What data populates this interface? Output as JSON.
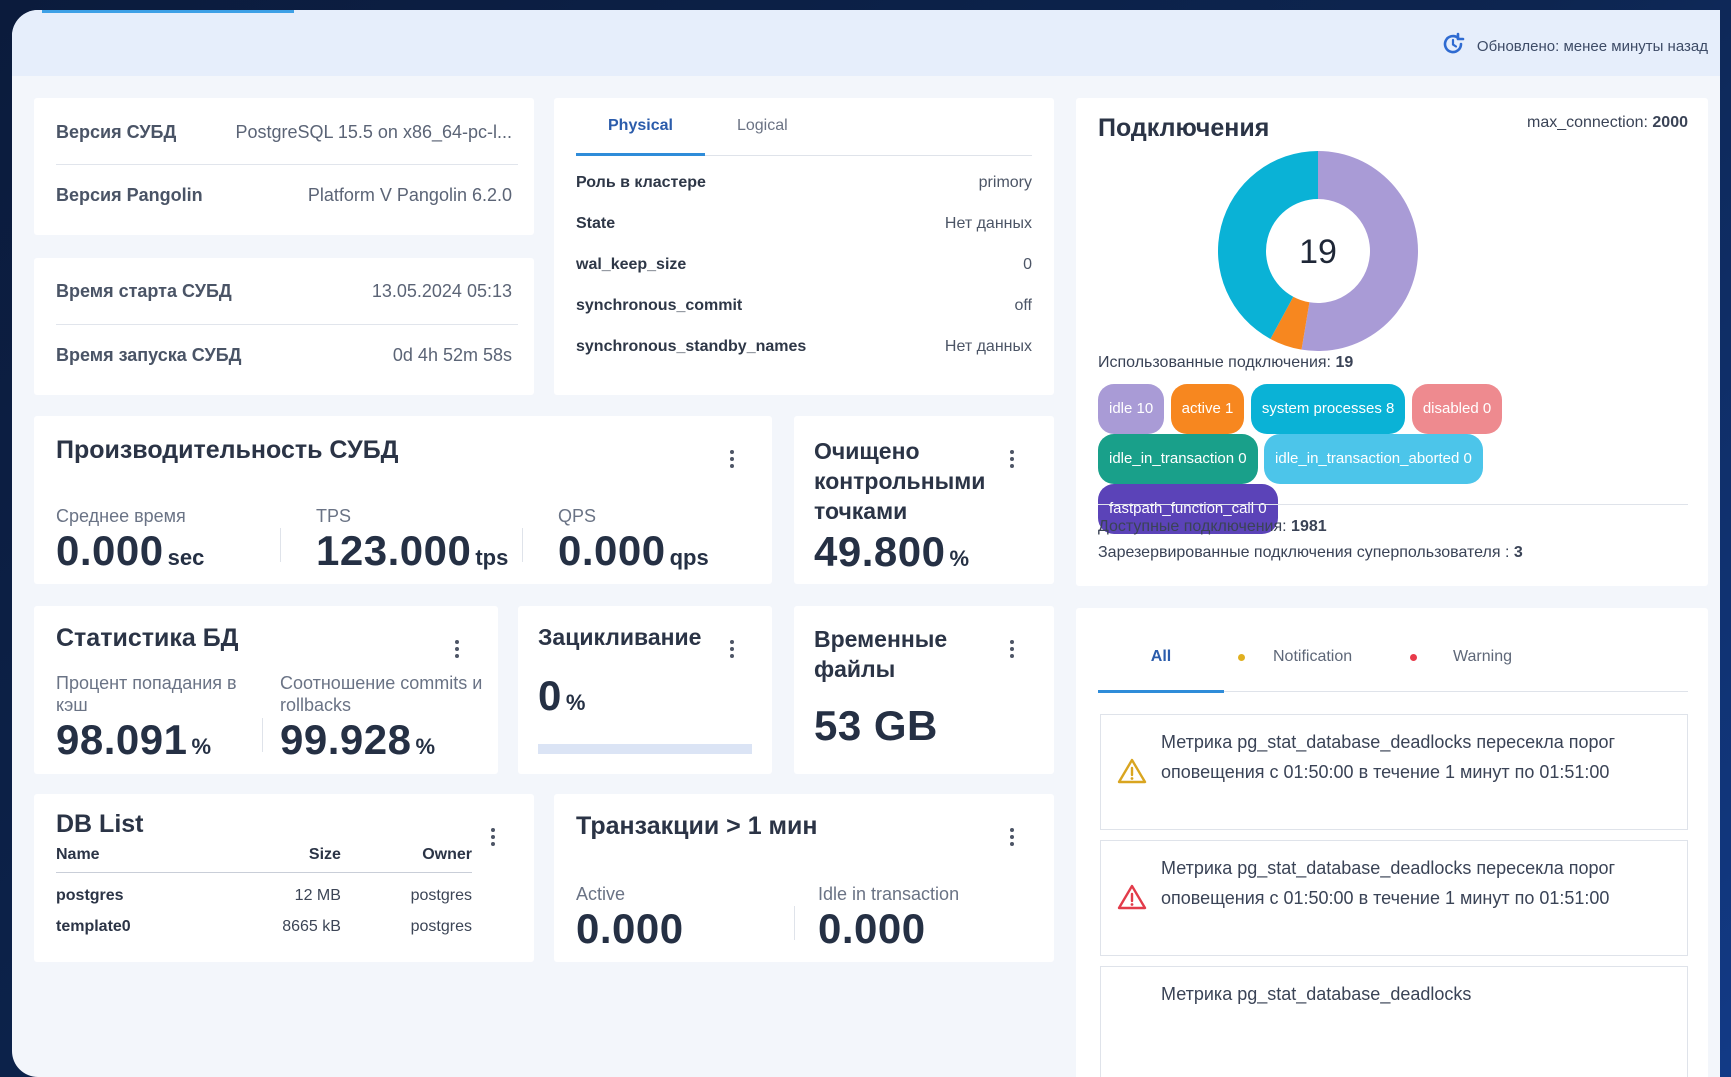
{
  "header": {
    "updated": "Обновлено: менее минуты назад"
  },
  "versions": {
    "rows": [
      {
        "label": "Версия СУБД",
        "value": "PostgreSQL 15.5 on x86_64-pc-l..."
      },
      {
        "label": "Версия Pangolin",
        "value": "Platform V Pangolin 6.2.0"
      }
    ]
  },
  "times": {
    "rows": [
      {
        "label": "Время старта СУБД",
        "value": "13.05.2024 05:13"
      },
      {
        "label": "Время запуска СУБД",
        "value": "0d 4h 52m 58s"
      }
    ]
  },
  "replication": {
    "tabs": [
      "Physical",
      "Logical"
    ],
    "active_tab": "Physical",
    "rows": [
      {
        "label": "Роль в кластере",
        "value": "primory"
      },
      {
        "label": "State",
        "value": "Нет данных"
      },
      {
        "label": "wal_keep_size",
        "value": "0"
      },
      {
        "label": "synchronous_commit",
        "value": "off"
      },
      {
        "label": "synchronous_standby_names",
        "value": "Нет данных"
      }
    ]
  },
  "connections": {
    "title": "Подключения",
    "max_label": "max_connection:",
    "max_value": "2000",
    "total": "19",
    "used_label": "Использованные подключения:",
    "used_value": "19",
    "available_label": "Доступные подключения:",
    "available_value": "1981",
    "reserved_label": "Зарезервированные подключения суперпользователя :",
    "reserved_value": "3",
    "pills": [
      {
        "label": "idle 10",
        "color": "#a99bd6"
      },
      {
        "label": "active 1",
        "color": "#f7871f"
      },
      {
        "label": "system processes 8",
        "color": "#0ab2d6"
      },
      {
        "label": "disabled 0",
        "color": "#ee8a8f"
      },
      {
        "label": "idle_in_transaction 0",
        "color": "#19a08a"
      },
      {
        "label": "idle_in_transaction_aborted 0",
        "color": "#4cc5ea"
      },
      {
        "label": "fastpath_function_call 0",
        "color": "#5b43b8"
      }
    ]
  },
  "chart_data": {
    "type": "pie",
    "categories": [
      "idle",
      "active",
      "system processes"
    ],
    "values": [
      10,
      1,
      8
    ],
    "colors": [
      "#a99bd6",
      "#f7871f",
      "#0ab2d6"
    ],
    "center_label": "19"
  },
  "performance": {
    "title": "Производительность СУБД",
    "metrics": [
      {
        "label": "Среднее время",
        "value": "0.000",
        "unit": "sec"
      },
      {
        "label": "TPS",
        "value": "123.000",
        "unit": "tps"
      },
      {
        "label": "QPS",
        "value": "0.000",
        "unit": "qps"
      }
    ]
  },
  "checkpoints": {
    "title": "Очищено контрольными точками",
    "value": "49.800",
    "unit": "%"
  },
  "dbstats": {
    "title": "Статистика БД",
    "cache_label": "Процент попадания в кэш",
    "cache_value": "98.091",
    "ratio_label": "Соотношение commits и rollbacks",
    "ratio_value": "99.928",
    "unit": "%"
  },
  "wraparound": {
    "title": "Зацикливание",
    "value": "0",
    "unit": "%",
    "progress": 0
  },
  "tempfiles": {
    "title": "Временные файлы",
    "value": "53 GB"
  },
  "dblist": {
    "title": "DB List",
    "columns": [
      "Name",
      "Size",
      "Owner"
    ],
    "rows": [
      [
        "postgres",
        "12 MB",
        "postgres"
      ],
      [
        "template0",
        "8665 kB",
        "postgres"
      ]
    ]
  },
  "transactions": {
    "title": "Транзакции > 1 мин",
    "active_label": "Active",
    "active_value": "0.000",
    "idle_label": "Idle in transaction",
    "idle_value": "0.000"
  },
  "notifications": {
    "tabs": [
      {
        "label": "All",
        "dot": ""
      },
      {
        "label": "Notification",
        "dot": "#e0b020"
      },
      {
        "label": "Warning",
        "dot": "#e83a4a"
      }
    ],
    "items": [
      {
        "text": "Метрика pg_stat_database_deadlocks пересекла порог оповещения с 01:50:00 в течение 1 минут по 01:51:00",
        "level": "notification",
        "color": "#d9a520"
      },
      {
        "text": "Метрика pg_stat_database_deadlocks пересекла порог оповещения с 01:50:00 в течение 1 минут по 01:51:00",
        "level": "warning",
        "color": "#e23b4a"
      },
      {
        "text": "Метрика pg_stat_database_deadlocks",
        "level": "notification",
        "color": "#d9a520"
      }
    ]
  }
}
